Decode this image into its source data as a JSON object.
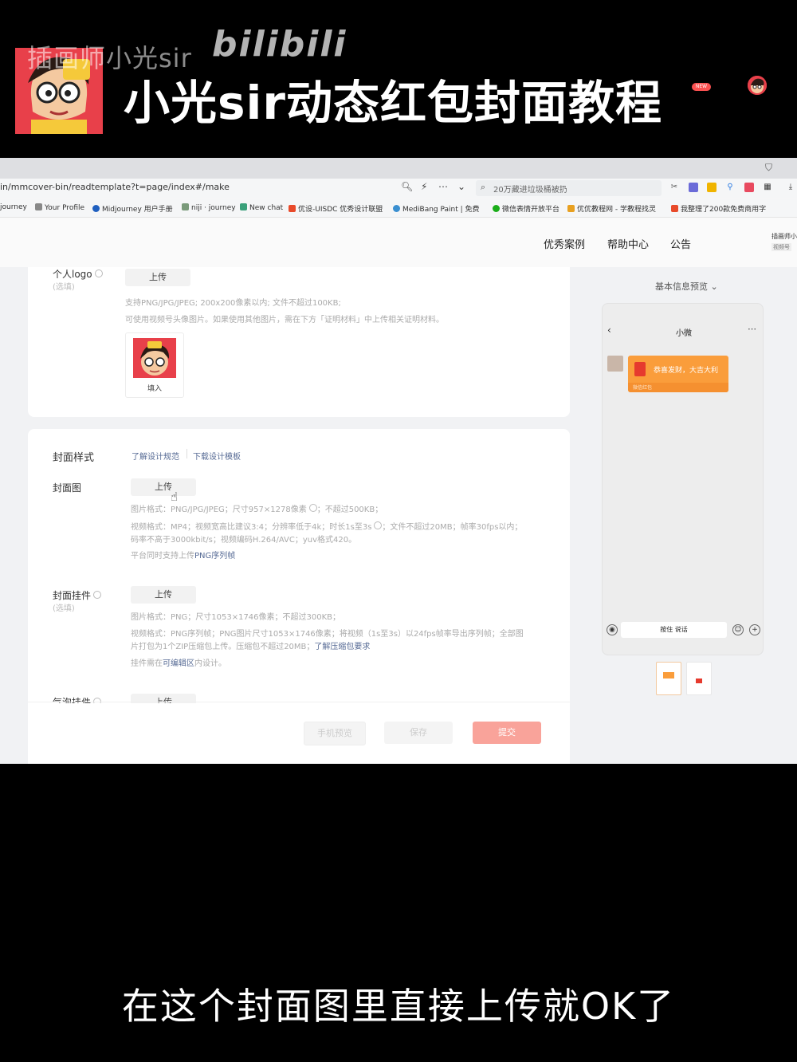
{
  "overlay": {
    "channel_name": "插画师小光sir",
    "platform_logo": "bilibili",
    "video_title": "小光sir动态红包封面教程",
    "subtitle": "在这个封面图里直接上传就OK了"
  },
  "browser": {
    "url": "in/mmcover-bin/readtemplate?t=page/index#/make",
    "search_text": "20万藏进垃圾桶被扔",
    "bookmarks": [
      "journey",
      "Your Profile",
      "Midjourney 用户手册",
      "niji · journey",
      "New chat",
      "优设-UISDC 优秀设计联盟",
      "MediBang Paint | 免费",
      "微信表情开放平台",
      "优优教程网 - 学教程找灵",
      "我整理了200款免费商用字"
    ]
  },
  "site_nav": {
    "items": [
      "优秀案例",
      "帮助中心",
      "公告"
    ],
    "new_badge": "NEW",
    "user_name": "插画师小",
    "user_tag": "视频号"
  },
  "logo_section": {
    "label": "个人logo",
    "optional": "(选填)",
    "upload": "上传",
    "hint1": "支持PNG/JPG/JPEG; 200x200像素以内; 文件不超过100KB;",
    "hint2": "可使用视频号头像图片。如果使用其他图片，需在下方「证明材料」中上传相关证明材料。",
    "thumb_action": "填入"
  },
  "cover_style": {
    "title": "封面样式",
    "link1": "了解设计规范",
    "link2": "下载设计模板",
    "cover_image": {
      "label": "封面图",
      "upload": "上传",
      "hint1": "图片格式：PNG/JPG/JPEG；尺寸957×1278像素",
      "hint1_tail": "；不超过500KB；",
      "hint2": "视频格式：MP4；视频宽高比建议3:4；分辨率低于4k；时长1s至3s",
      "hint2_tail": "；文件不超过20MB；帧率30fps以内；",
      "hint3": "码率不高于3000kbit/s；视频编码H.264/AVC；yuv格式420。",
      "hint4": "平台同时支持上传",
      "hint4_link": "PNG序列帧"
    },
    "cover_pendant": {
      "label": "封面挂件",
      "optional": "(选填)",
      "upload": "上传",
      "hint1": "图片格式：PNG；尺寸1053×1746像素；不超过300KB；",
      "hint2": "视频格式：PNG序列帧；PNG图片尺寸1053×1746像素；将视频（1s至3s）以24fps帧率导出序列帧；全部图",
      "hint3": "片打包为1个ZIP压缩包上传。压缩包不超过20MB；",
      "hint3_link": "了解压缩包要求",
      "hint4": "挂件需在",
      "hint4_link": "可编辑区",
      "hint4_tail": "内设计。"
    },
    "bubble_pendant": {
      "label": "气泡挂件",
      "upload": "上传"
    }
  },
  "footer_buttons": {
    "preview": "手机预览",
    "save": "保存",
    "submit": "提交"
  },
  "preview": {
    "label": "基本信息预览",
    "chat_title": "小微",
    "red_packet_text": "恭喜发财，大吉大利",
    "red_packet_footer": "微信红包",
    "input_text": "按住 说话"
  },
  "colors": {
    "accent_red": "#fa5151",
    "submit_light": "#f9a39a",
    "red_packet": "#fa9d3b",
    "link": "#576b95"
  }
}
